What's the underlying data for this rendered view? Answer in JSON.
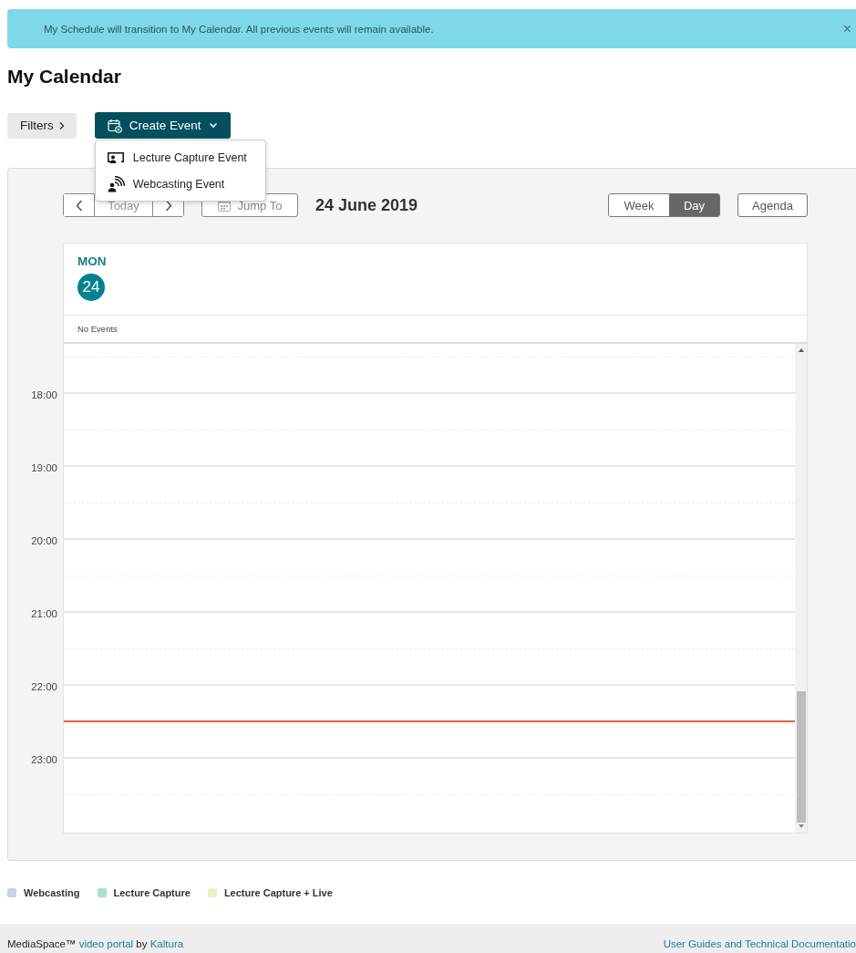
{
  "banner": {
    "text": "My Schedule will transition to My Calendar. All previous events will remain available.",
    "close": "×"
  },
  "title": "My Calendar",
  "filters_button": {
    "label": "Filters"
  },
  "create_event": {
    "label": "Create Event",
    "expanded": true,
    "menu": [
      {
        "label": "Lecture Capture Event",
        "kind": "lecture"
      },
      {
        "label": "Webcasting Event",
        "kind": "webcast"
      }
    ]
  },
  "toolbar": {
    "today": "Today",
    "jump_to": "Jump To",
    "date": "24 June 2019",
    "views": [
      {
        "label": "Week",
        "selected": false
      },
      {
        "label": "Day",
        "selected": true
      }
    ],
    "agenda": "Agenda"
  },
  "day": {
    "weekday": "MON",
    "date": "24",
    "all_day": "No Events",
    "hours": [
      "18:00",
      "19:00",
      "20:00",
      "21:00",
      "22:00",
      "23:00"
    ]
  },
  "legend": [
    {
      "label": "Webcasting",
      "color": "#c5d3ee"
    },
    {
      "label": "Lecture Capture",
      "color": "#a8e0d2"
    },
    {
      "label": "Lecture Capture + Live",
      "color": "#e8f0c6"
    }
  ],
  "footer": {
    "brand": "MediaSpace™",
    "portal_link": "video portal",
    "by": "by",
    "vendor_link": "Kaltura",
    "docs_link": "User Guides and Technical Documentatio"
  }
}
